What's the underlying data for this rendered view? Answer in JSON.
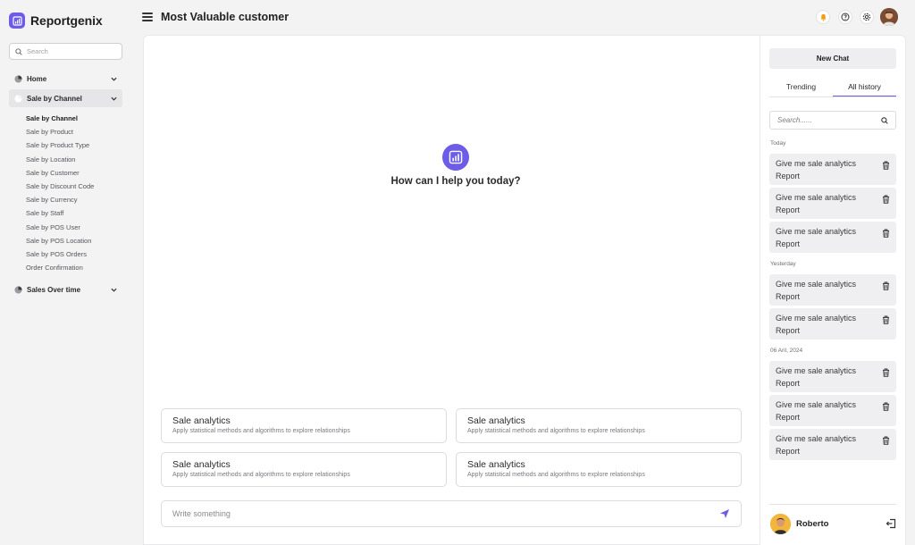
{
  "app": {
    "name": "Reportgenix",
    "accent": "#6c5ce7"
  },
  "sidebar": {
    "search_placeholder": "Search",
    "groups": [
      {
        "label": "Home",
        "icon": "pie-chart-icon"
      },
      {
        "label": "Sale by Channel",
        "icon": "pie-chart-icon"
      },
      {
        "label": "Sales Over time",
        "icon": "pie-chart-icon"
      }
    ],
    "sub_items": [
      "Sale by Channel",
      "Sale by Product",
      "Sale by Product Type",
      "Sale by Location",
      "Sale by Customer",
      "Sale by Discount Code",
      "Sale by Currency",
      "Sale by Staff",
      "Sale by POS User",
      "Sale by POS Location",
      "Sale by POS Orders",
      "Order Confirmation"
    ]
  },
  "header": {
    "title": "Most Valuable customer",
    "icons": [
      "bell-icon",
      "help-icon",
      "settings-icon",
      "avatar"
    ]
  },
  "main": {
    "greeting": "How can I help you today?",
    "cards": [
      {
        "title": "Sale analytics",
        "desc": "Apply statistical methods and algorithms to explore relationships"
      },
      {
        "title": "Sale analytics",
        "desc": "Apply statistical methods and algorithms to explore relationships"
      },
      {
        "title": "Sale analytics",
        "desc": "Apply statistical methods and algorithms to explore relationships"
      },
      {
        "title": "Sale analytics",
        "desc": "Apply statistical methods and algorithms to explore relationships"
      }
    ],
    "compose_placeholder": "Write something"
  },
  "history": {
    "new_chat": "New Chat",
    "tabs": [
      "Trending",
      "All history"
    ],
    "search_placeholder": "Search......",
    "sections": [
      {
        "label": "Today",
        "items": [
          "Give me sale analytics Report",
          "Give me sale analytics Report",
          "Give me sale analytics Report"
        ]
      },
      {
        "label": "Yesterday",
        "items": [
          "Give me sale analytics Report",
          "Give me sale analytics Report"
        ]
      },
      {
        "label": "06 Aril, 2024",
        "items": [
          "Give me sale analytics Report",
          "Give me sale analytics Report",
          "Give me sale analytics Report"
        ]
      }
    ]
  },
  "user": {
    "name": "Roberto"
  }
}
